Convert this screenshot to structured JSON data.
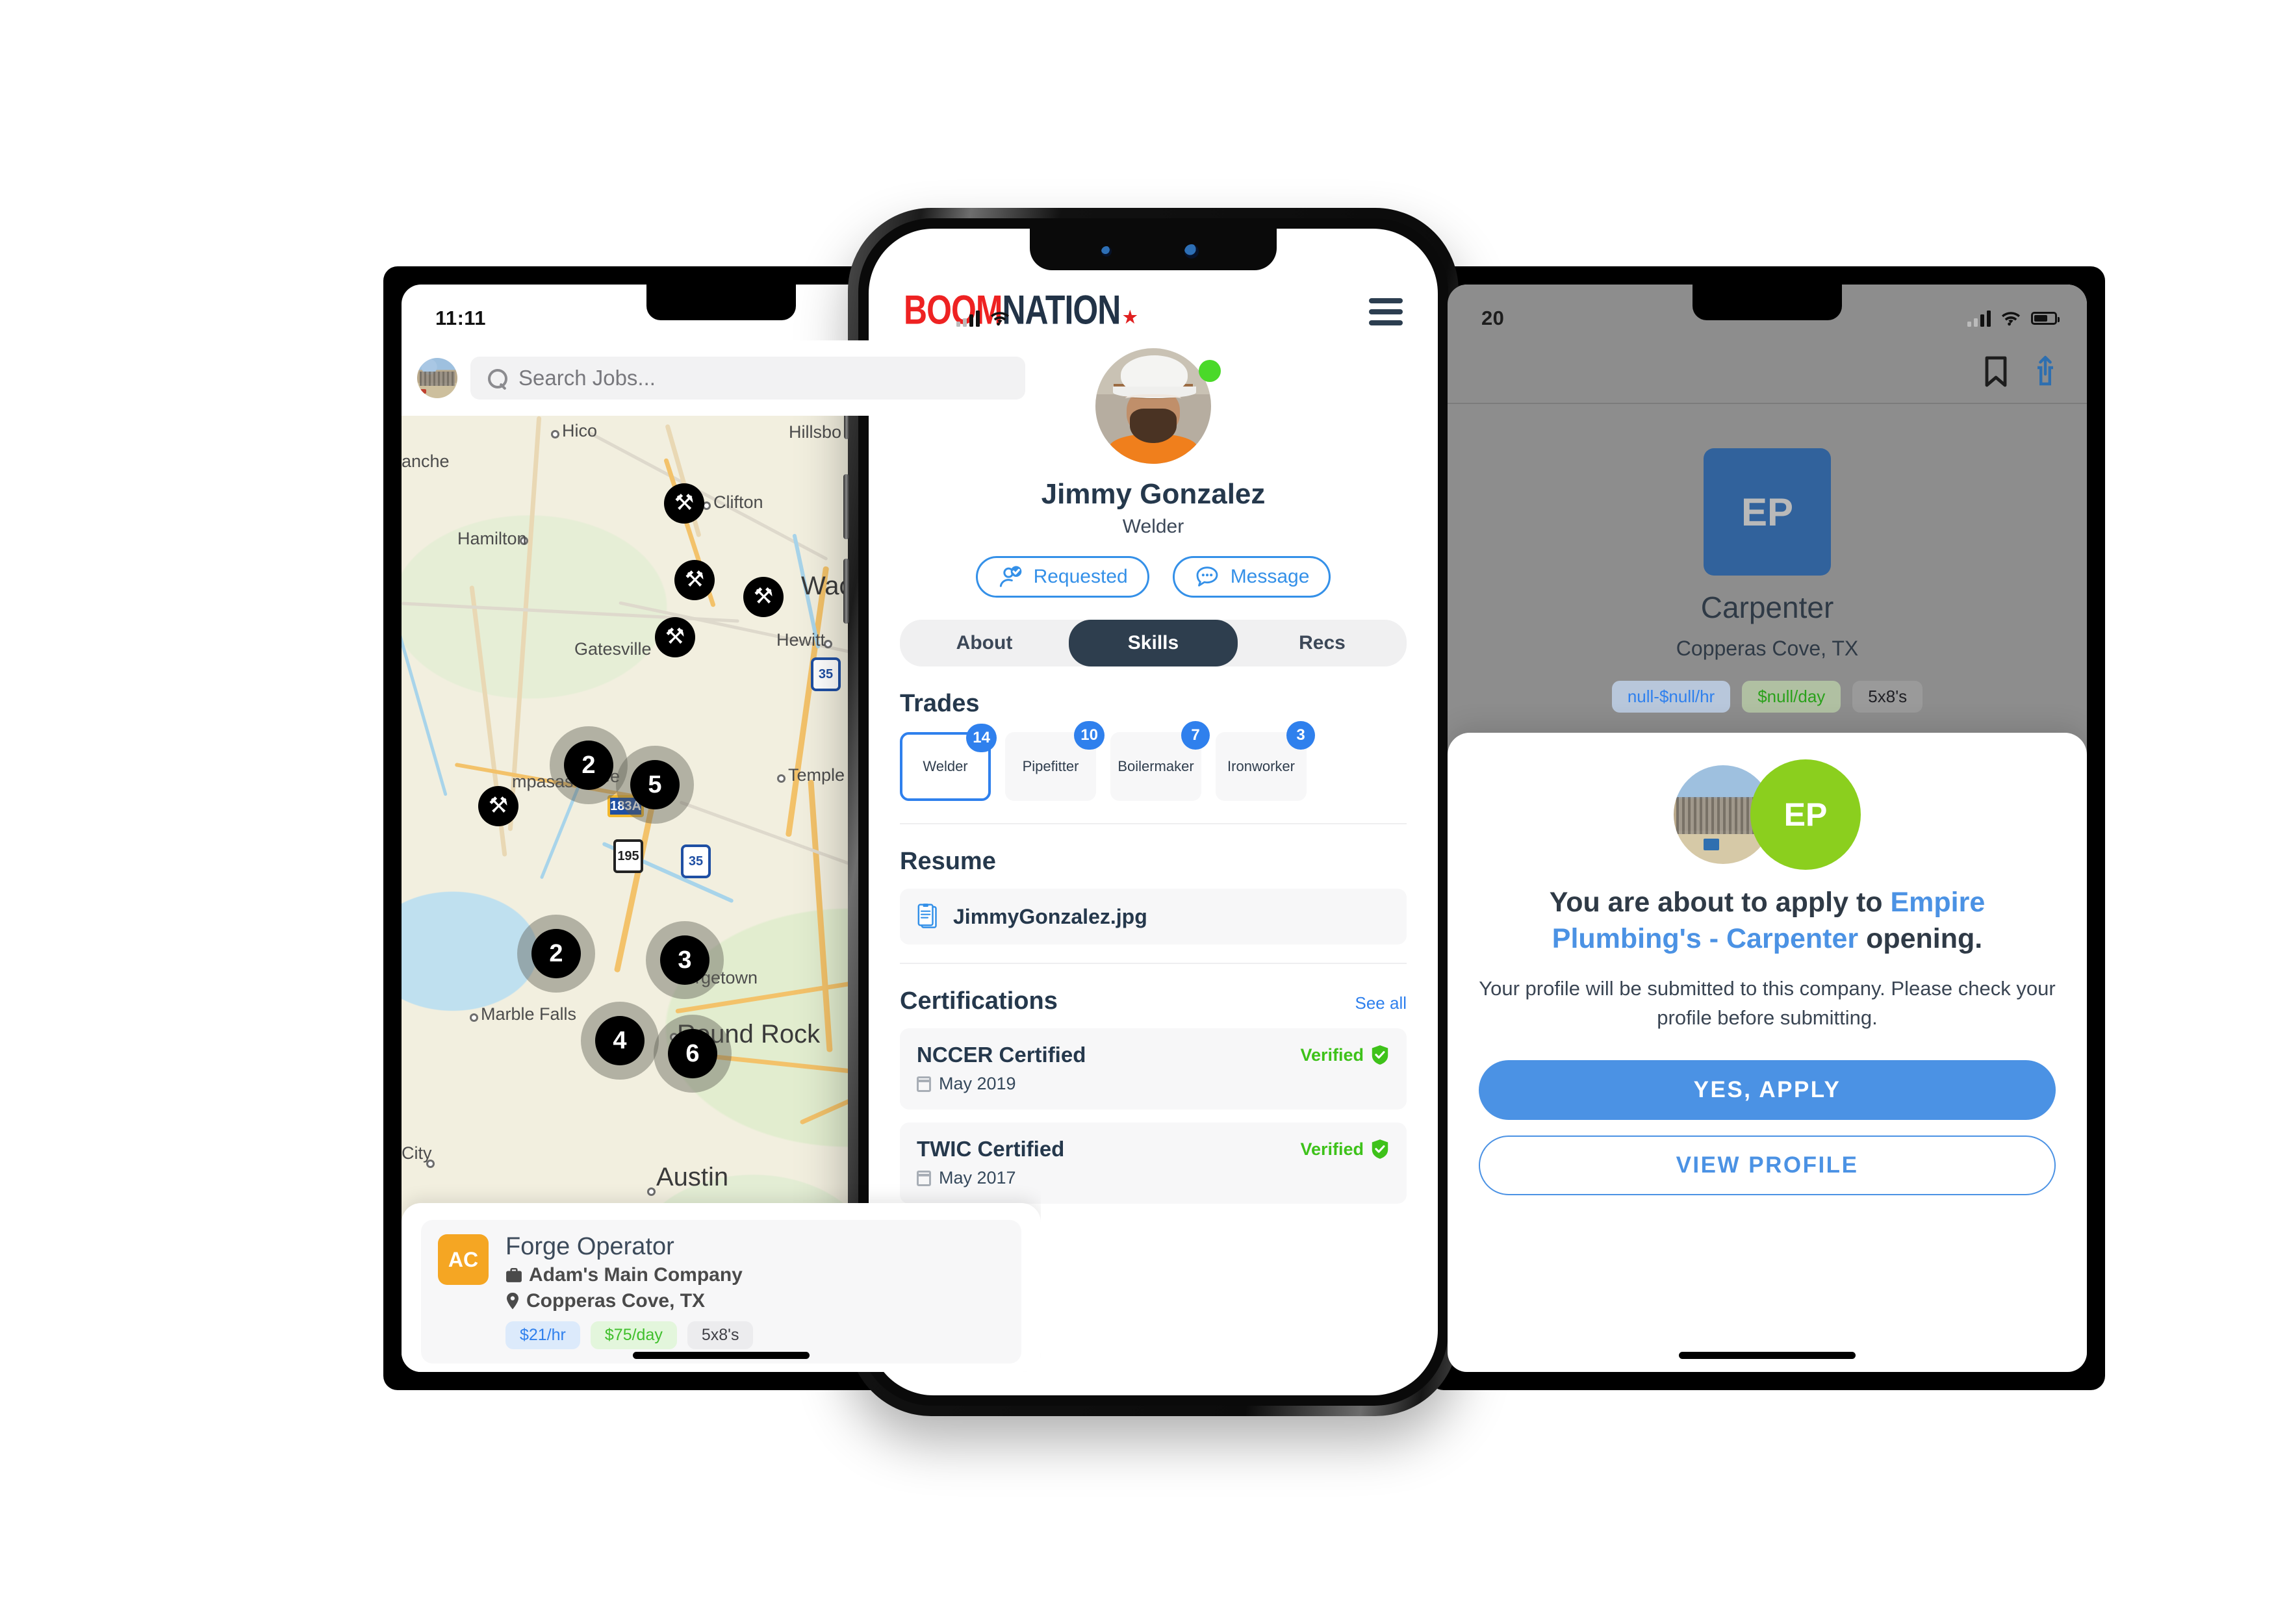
{
  "left_phone": {
    "status": {
      "time": "11:11"
    },
    "search": {
      "placeholder": "Search Jobs...",
      "icon": "search-icon",
      "avatar": "user-avatar"
    },
    "map": {
      "labels": [
        {
          "text": "Hico"
        },
        {
          "text": "Hillsbo"
        },
        {
          "text": "anche"
        },
        {
          "text": "Clifton"
        },
        {
          "text": "Hamilton"
        },
        {
          "text": "Waco"
        },
        {
          "text": "Gatesville"
        },
        {
          "text": "Hewitt"
        },
        {
          "text": "mpasas"
        },
        {
          "text": "lee"
        },
        {
          "text": "Temple"
        },
        {
          "text": "Marble Falls"
        },
        {
          "text": "rgetown"
        },
        {
          "text": "Round Rock"
        },
        {
          "text": "City"
        },
        {
          "text": "Austin"
        }
      ],
      "shields": [
        "35",
        "195",
        "35",
        "183A",
        "35"
      ],
      "pins": [
        {
          "type": "tools"
        },
        {
          "type": "tools"
        },
        {
          "type": "tools"
        },
        {
          "type": "tools"
        },
        {
          "type": "tools"
        },
        {
          "type": "cluster",
          "count": "2"
        },
        {
          "type": "cluster",
          "count": "5"
        },
        {
          "type": "cluster",
          "count": "2"
        },
        {
          "type": "cluster",
          "count": "3"
        },
        {
          "type": "cluster",
          "count": "4"
        },
        {
          "type": "cluster",
          "count": "6"
        }
      ]
    },
    "job_card": {
      "logo_initials": "AC",
      "title": "Forge Operator",
      "company": "Adam's Main Company",
      "location": "Copperas Cove, TX",
      "pills": [
        {
          "label": "$21/hr",
          "style": "blue"
        },
        {
          "label": "$75/day",
          "style": "green"
        },
        {
          "label": "5x8's",
          "style": "grey"
        }
      ]
    }
  },
  "center_phone": {
    "brand": {
      "part1": "BOOM",
      "part2": "NATION",
      "star": "★"
    },
    "menu_icon": "hamburger-menu-icon",
    "profile": {
      "name": "Jimmy Gonzalez",
      "role": "Welder",
      "online": true,
      "actions": [
        {
          "label": "Requested",
          "icon": "request-verified-icon"
        },
        {
          "label": "Message",
          "icon": "chat-bubble-icon"
        }
      ]
    },
    "tabs": [
      {
        "label": "About",
        "active": false
      },
      {
        "label": "Skills",
        "active": true
      },
      {
        "label": "Recs",
        "active": false
      }
    ],
    "trades": {
      "heading": "Trades",
      "items": [
        {
          "label": "Welder",
          "count": "14",
          "selected": true
        },
        {
          "label": "Pipefitter",
          "count": "10",
          "selected": false
        },
        {
          "label": "Boilermaker",
          "count": "7",
          "selected": false
        },
        {
          "label": "Ironworker",
          "count": "3",
          "selected": false
        }
      ]
    },
    "resume": {
      "heading": "Resume",
      "file_name": "JimmyGonzalez.jpg",
      "file_icon": "document-icon"
    },
    "certifications": {
      "heading": "Certifications",
      "see_all": "See all",
      "items": [
        {
          "name": "NCCER Certified",
          "date": "May 2019",
          "status": "Verified"
        },
        {
          "name": "TWIC Certified",
          "date": "May 2017",
          "status": "Verified"
        }
      ]
    }
  },
  "right_phone": {
    "status": {
      "time": "20"
    },
    "toolbar": [
      {
        "icon": "bookmark-icon"
      },
      {
        "icon": "share-icon"
      }
    ],
    "job": {
      "logo_initials": "EP",
      "title": "Carpenter",
      "location": "Copperas Cove, TX",
      "pills": [
        {
          "label": "null-$null/hr",
          "style": "blue"
        },
        {
          "label": "$null/day",
          "style": "green"
        },
        {
          "label": "5x8's",
          "style": "grey"
        }
      ]
    },
    "modal": {
      "badge_initials": "EP",
      "title_pre": "You are about to apply to ",
      "title_hl": "Empire Plumbing's - Carpenter",
      "title_post": " opening.",
      "body": "Your profile will be submitted to this company. Please check your profile before submitting.",
      "primary_button": "YES, APPLY",
      "secondary_button": "VIEW PROFILE"
    }
  },
  "colors": {
    "brand_red": "#ee2222",
    "brand_navy": "#223347",
    "accent_blue": "#2f80ed",
    "verified_green": "#3ec21a",
    "badge_green": "#8bcf1e",
    "tab_dark": "#2e3e4e"
  }
}
